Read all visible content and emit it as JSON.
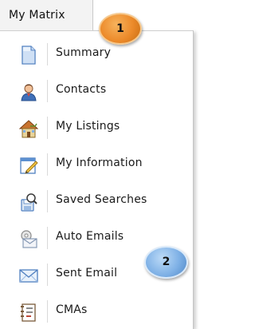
{
  "tab": {
    "label": "My Matrix"
  },
  "menu": {
    "items": [
      {
        "label": "Summary",
        "icon": "document-icon"
      },
      {
        "label": "Contacts",
        "icon": "contact-person-icon"
      },
      {
        "label": "My Listings",
        "icon": "house-icon"
      },
      {
        "label": "My Information",
        "icon": "edit-form-icon"
      },
      {
        "label": "Saved Searches",
        "icon": "saved-search-icon"
      },
      {
        "label": "Auto Emails",
        "icon": "auto-email-icon"
      },
      {
        "label": "Sent Email",
        "icon": "envelope-icon"
      },
      {
        "label": "CMAs",
        "icon": "cma-report-icon"
      }
    ]
  },
  "callouts": [
    {
      "number": "1",
      "color": "#ec8a2a"
    },
    {
      "number": "2",
      "color": "#7fb1e6"
    }
  ]
}
